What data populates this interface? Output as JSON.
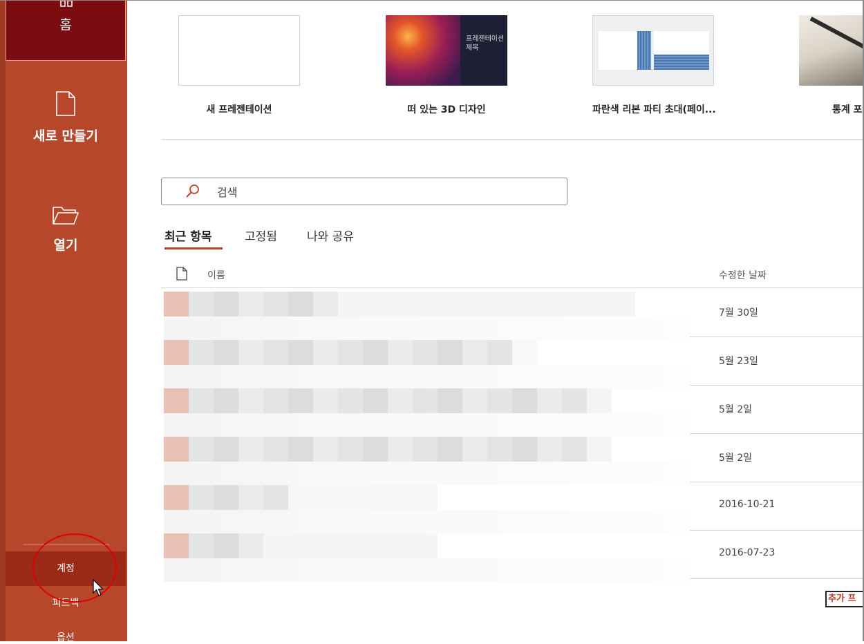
{
  "sidebar": {
    "home_label": "홈",
    "new_label": "새로 만들기",
    "open_label": "열기",
    "account_label": "계정",
    "feedback_label": "피드백",
    "options_label": "옵션"
  },
  "templates": [
    {
      "name": "새 프레젠테이션",
      "icon": "blank-template-thumbnail"
    },
    {
      "name": "떠 있는 3D 디자인",
      "icon": "3d-design-thumbnail",
      "thumb_text": "프레젠테이션 제목"
    },
    {
      "name": "파란색 리본 파티 초대(페이...",
      "icon": "ribbon-party-thumbnail"
    },
    {
      "name": "통계 포",
      "icon": "statistics-thumbnail"
    }
  ],
  "search": {
    "placeholder": "검색"
  },
  "tabs": [
    {
      "label": "최근 항목",
      "active": true
    },
    {
      "label": "고정됨",
      "active": false
    },
    {
      "label": "나와 공유",
      "active": false
    }
  ],
  "list": {
    "col_name": "이름",
    "col_date": "수정한 날짜",
    "rows": [
      {
        "date": "7월 30일"
      },
      {
        "date": "5월 23일"
      },
      {
        "date": "5월 2일"
      },
      {
        "date": "5월 2일"
      },
      {
        "date": "2016-10-21"
      },
      {
        "date": "2016-07-23"
      }
    ]
  },
  "more_link": "추가 프",
  "colors": {
    "accent": "#b7472a",
    "home_selected": "#7a0c12",
    "annotation": "#e00000"
  }
}
